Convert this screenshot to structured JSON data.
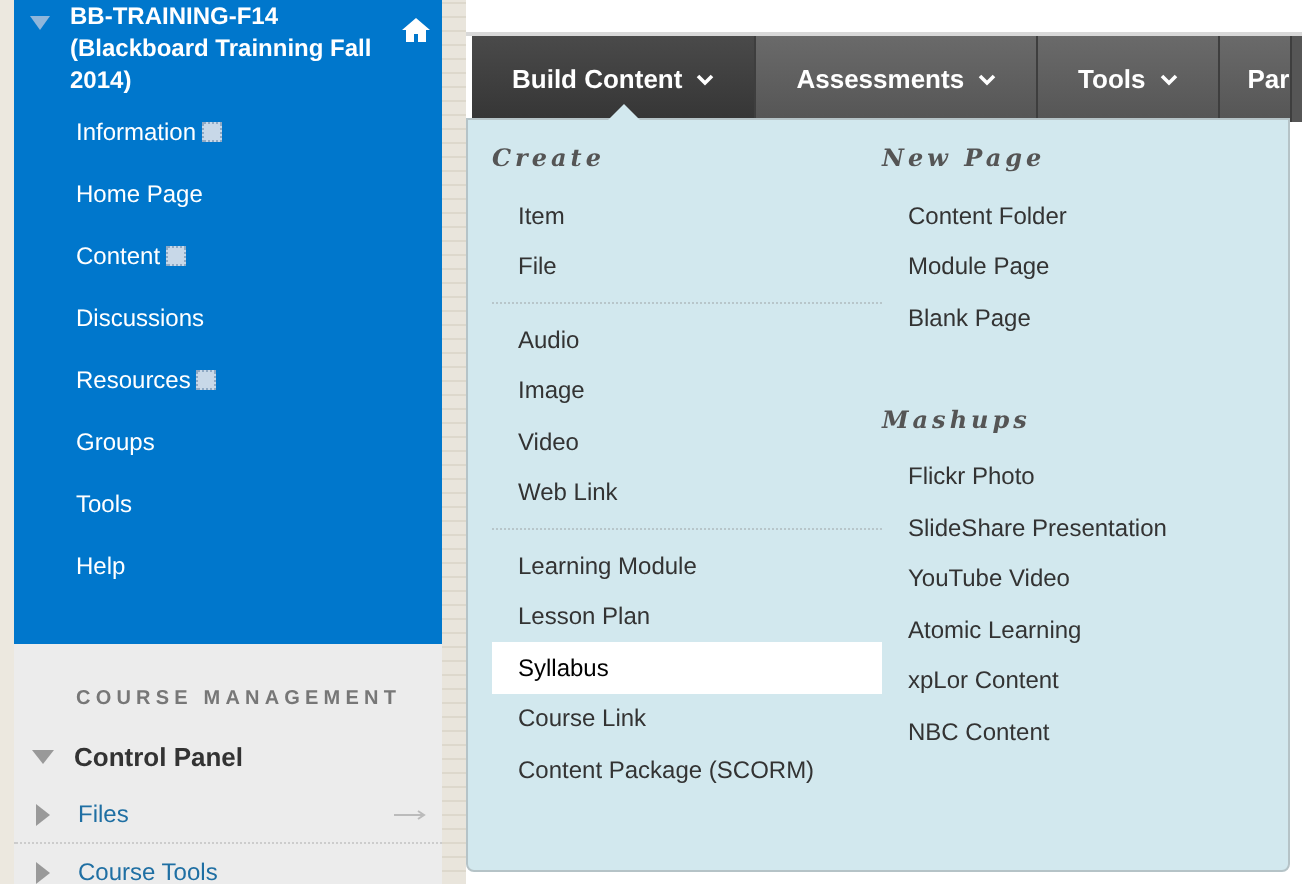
{
  "course": {
    "title": "BB-TRAINING-F14 (Blackboard Trainning Fall 2014)",
    "expanded": true,
    "items": [
      {
        "label": "Information",
        "marked": true
      },
      {
        "label": "Home Page",
        "marked": false
      },
      {
        "label": "Content",
        "marked": true
      },
      {
        "label": "Discussions",
        "marked": false
      },
      {
        "label": "Resources",
        "marked": true
      },
      {
        "label": "Groups",
        "marked": false
      },
      {
        "label": "Tools",
        "marked": false
      },
      {
        "label": "Help",
        "marked": false
      }
    ]
  },
  "course_management": {
    "heading": "COURSE MANAGEMENT",
    "panel": {
      "label": "Control Panel",
      "expanded": true
    },
    "items": [
      {
        "label": "Files",
        "expanded": false,
        "hovered": true
      },
      {
        "label": "Course Tools",
        "expanded": false,
        "hovered": false
      }
    ]
  },
  "tabs": [
    {
      "label": "Build Content",
      "selected": true
    },
    {
      "label": "Assessments",
      "selected": false
    },
    {
      "label": "Tools",
      "selected": false
    },
    {
      "label": "Par",
      "selected": false
    }
  ],
  "menu": {
    "columns": [
      {
        "sections": [
          {
            "heading": "Create",
            "groups": [
              [
                {
                  "label": "Item",
                  "selected": false
                },
                {
                  "label": "File",
                  "selected": false
                }
              ],
              [
                {
                  "label": "Audio",
                  "selected": false
                },
                {
                  "label": "Image",
                  "selected": false
                },
                {
                  "label": "Video",
                  "selected": false
                },
                {
                  "label": "Web Link",
                  "selected": false
                }
              ],
              [
                {
                  "label": "Learning Module",
                  "selected": false
                },
                {
                  "label": "Lesson Plan",
                  "selected": false
                },
                {
                  "label": "Syllabus",
                  "selected": true
                },
                {
                  "label": "Course Link",
                  "selected": false
                },
                {
                  "label": "Content Package (SCORM)",
                  "selected": false
                }
              ]
            ]
          }
        ]
      },
      {
        "sections": [
          {
            "heading": "New Page",
            "groups": [
              [
                {
                  "label": "Content Folder",
                  "selected": false
                },
                {
                  "label": "Module Page",
                  "selected": false
                },
                {
                  "label": "Blank Page",
                  "selected": false
                }
              ]
            ]
          },
          {
            "heading": "Mashups",
            "groups": [
              [
                {
                  "label": "Flickr Photo",
                  "selected": false
                },
                {
                  "label": "SlideShare Presentation",
                  "selected": false
                },
                {
                  "label": "YouTube Video",
                  "selected": false
                },
                {
                  "label": "Atomic Learning",
                  "selected": false
                },
                {
                  "label": "xpLor Content",
                  "selected": false
                },
                {
                  "label": "NBC Content",
                  "selected": false
                }
              ]
            ]
          }
        ]
      }
    ]
  }
}
